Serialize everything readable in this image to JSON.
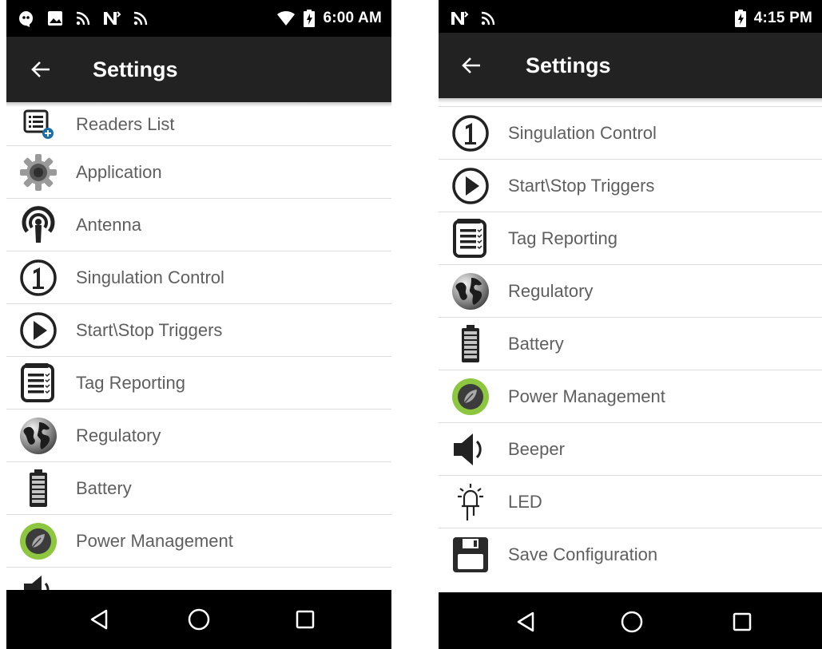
{
  "left_phone": {
    "status_bar": {
      "left_icons": [
        "chat-icon",
        "image-icon",
        "rss-icon",
        "nfc-icon",
        "rss-icon"
      ],
      "right_icons": [
        "wifi-icon",
        "battery-charging-icon"
      ],
      "time": "6:00 AM"
    },
    "app_bar": {
      "title": "Settings",
      "back_icon": "arrow-left-icon"
    },
    "items": [
      {
        "label": "Readers List",
        "icon": "readers-list-icon"
      },
      {
        "label": "Application",
        "icon": "gear-icon"
      },
      {
        "label": "Antenna",
        "icon": "antenna-icon"
      },
      {
        "label": "Singulation Control",
        "icon": "number-one-icon"
      },
      {
        "label": "Start\\Stop Triggers",
        "icon": "play-icon"
      },
      {
        "label": "Tag Reporting",
        "icon": "report-list-icon"
      },
      {
        "label": "Regulatory",
        "icon": "globe-icon"
      },
      {
        "label": "Battery",
        "icon": "battery-icon"
      },
      {
        "label": "Power Management",
        "icon": "power-leaf-icon"
      }
    ],
    "partial_item_icon": "speaker-icon"
  },
  "right_phone": {
    "status_bar": {
      "left_icons": [
        "nfc-icon",
        "rss-icon"
      ],
      "right_icons": [
        "battery-charging-icon"
      ],
      "time": "4:15 PM"
    },
    "app_bar": {
      "title": "Settings",
      "back_icon": "arrow-left-icon"
    },
    "items": [
      {
        "label": "Singulation Control",
        "icon": "number-one-icon"
      },
      {
        "label": "Start\\Stop Triggers",
        "icon": "play-icon"
      },
      {
        "label": "Tag Reporting",
        "icon": "report-list-icon"
      },
      {
        "label": "Regulatory",
        "icon": "globe-icon"
      },
      {
        "label": "Battery",
        "icon": "battery-icon"
      },
      {
        "label": "Power Management",
        "icon": "power-leaf-icon"
      },
      {
        "label": "Beeper",
        "icon": "speaker-icon"
      },
      {
        "label": "LED",
        "icon": "led-icon"
      },
      {
        "label": "Save Configuration",
        "icon": "floppy-icon"
      }
    ]
  },
  "nav_bar": {
    "buttons": [
      "back-triangle-icon",
      "home-circle-icon",
      "recents-square-icon"
    ]
  },
  "colors": {
    "status_bar": "#000000",
    "app_bar": "#222222",
    "nav_bar": "#000000",
    "label_text": "#5f5f5f",
    "accent_green": "#8dc63f"
  }
}
